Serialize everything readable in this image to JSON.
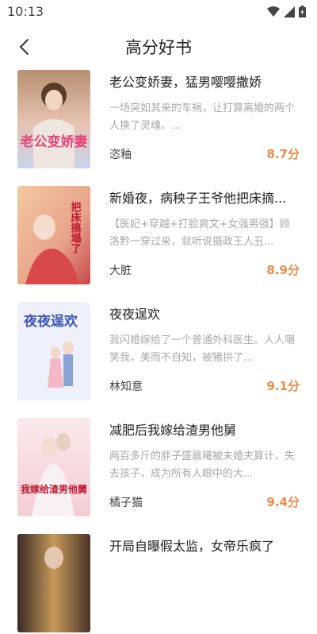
{
  "status": {
    "time": "10:13"
  },
  "header": {
    "title": "高分好书"
  },
  "colors": {
    "score": "#f08a45",
    "desc": "#a9a9a9"
  },
  "books": [
    {
      "title": "老公变娇妻，猛男嘤嘤撒娇",
      "desc": "一场突如其来的车祸，让打算离婚的两个人换了灵魂。...",
      "author": "恣釉",
      "score": "8.7分",
      "cover_text": "老公变娇妻"
    },
    {
      "title": "新婚夜，病秧子王爷他把床摘...",
      "desc": "【医妃+穿越+打脸爽文+女强男强】顾洛黔一穿过来，就听说摄政王人丑...",
      "author": "大脏",
      "score": "8.9分",
      "cover_text": "把床搞塌了"
    },
    {
      "title": "夜夜逞欢",
      "desc": "我闪婚嫁给了一个普通外科医生。人人嘲笑我，美而不自知，被猪拱了...",
      "author": "林知意",
      "score": "9.1分",
      "cover_text": "夜夜逞欢"
    },
    {
      "title": "减肥后我嫁给渣男他舅",
      "desc": "两百多斤的胖子盛晨曦被未婚夫算计，失去孩子，成为所有人眼中的大...",
      "author": "橘子猫",
      "score": "9.4分",
      "cover_text": "我嫁给渣男他舅"
    },
    {
      "title": "开局自曝假太监，女帝乐疯了",
      "desc": "",
      "author": "",
      "score": "",
      "cover_text": ""
    }
  ]
}
